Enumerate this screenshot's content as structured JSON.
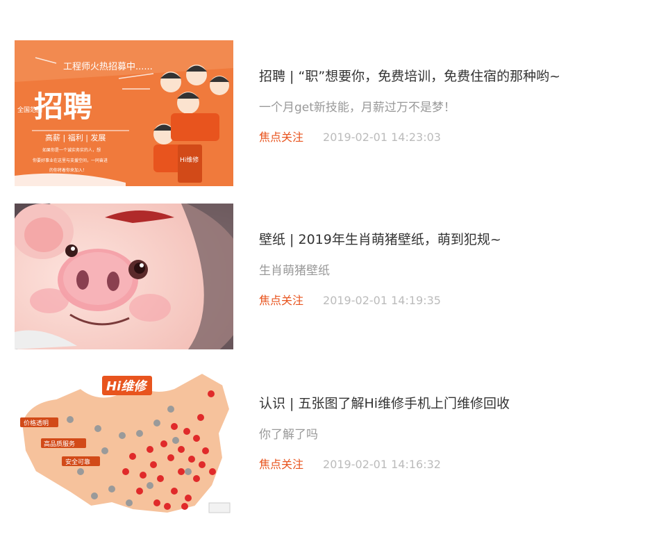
{
  "articles": [
    {
      "title": "招聘 | “职”想要你，免费培训，免费住宿的那种哟~",
      "desc": "一个月get新技能，月薪过万不是梦！",
      "tag": "焦点关注",
      "time": "2019-02-01 14:23:03",
      "thumb": {
        "banner": "工程师火热招募中......",
        "big": "招聘",
        "badge": "全国范围",
        "perks": "高薪 | 福利 | 发展",
        "line1": "如果你是一个诚实务实的人，想",
        "line2": "你要好事业在这里与支援空间，一同奋进",
        "line3": "的你将着你来加入！",
        "brand": "Hi维修",
        "accent": "#f07a3c"
      }
    },
    {
      "title": "壁纸 | 2019年生肖萌猪壁纸，萌到犯规~",
      "desc": "生肖萌猪壁纸",
      "tag": "焦点关注",
      "time": "2019-02-01 14:19:35",
      "thumb": {
        "accent": "#f4b6b6"
      }
    },
    {
      "title": "认识 | 五张图了解Hi维修手机上门维修回收",
      "desc": "你了解了吗",
      "tag": "焦点关注",
      "time": "2019-02-01 14:16:32",
      "thumb": {
        "brand": "Hi维修",
        "label1": "价格透明",
        "label2": "高品质服务",
        "label3": "安全可靠",
        "accent": "#e8541e"
      }
    }
  ],
  "colors": {
    "title": "#333333",
    "desc": "#999999",
    "tag": "#e8541e",
    "time": "#bbbbbb"
  }
}
